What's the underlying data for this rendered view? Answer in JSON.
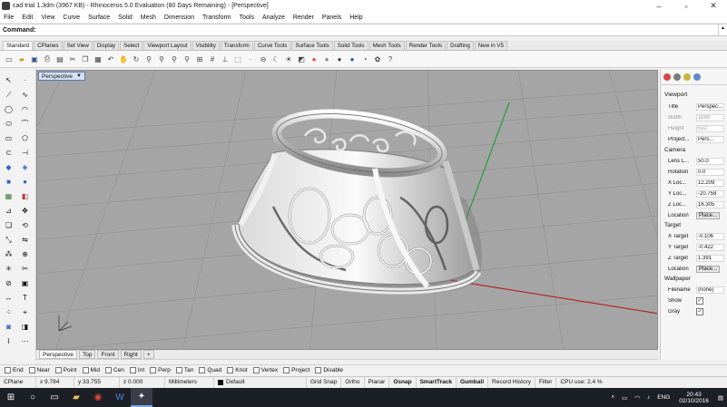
{
  "window": {
    "title": "cad trial 1.3dm (3967 KB) - Rhinoceros 5.0 Evaluation (80 Days Remaining) - [Perspective]"
  },
  "menu": [
    "File",
    "Edit",
    "View",
    "Curve",
    "Surface",
    "Solid",
    "Mesh",
    "Dimension",
    "Transform",
    "Tools",
    "Analyze",
    "Render",
    "Panels",
    "Help"
  ],
  "command": {
    "label": "Command:",
    "value": ""
  },
  "toolbar_tabs": [
    "Standard",
    "CPlanes",
    "Set View",
    "Display",
    "Select",
    "Viewport Layout",
    "Visibility",
    "Transform",
    "Curve Tools",
    "Surface Tools",
    "Solid Tools",
    "Mesh Tools",
    "Render Tools",
    "Drafting",
    "New in V5"
  ],
  "active_toolbar_tab": "Standard",
  "viewport": {
    "label": "Perspective"
  },
  "viewport_tabs": [
    "Perspective",
    "Top",
    "Front",
    "Right"
  ],
  "properties": {
    "section_viewport": "Viewport",
    "title_label": "Title",
    "title_value": "Perspec...",
    "width_label": "Width",
    "width_value": "1168",
    "height_label": "Height",
    "height_value": "522",
    "projection_label": "Project...",
    "projection_value": "Pers...",
    "section_camera": "Camera",
    "lens_label": "Lens L...",
    "lens_value": "50.0",
    "rotation_label": "Rotation",
    "rotation_value": "0.0",
    "xloc_label": "X Loc...",
    "xloc_value": "12.209",
    "yloc_label": "Y Loc...",
    "yloc_value": "-20.758",
    "zloc_label": "Z Loc...",
    "zloc_value": "16.305",
    "location_label": "Location",
    "place_button": "Place...",
    "section_target": "Target",
    "xtarget_label": "X Target",
    "xtarget_value": "-0.106",
    "ytarget_label": "Y Target",
    "ytarget_value": "-0.422",
    "ztarget_label": "Z Target",
    "ztarget_value": "1.391",
    "target_location_label": "Location",
    "target_place_button": "Place...",
    "section_wallpaper": "Wallpaper",
    "filename_label": "Filename",
    "filename_value": "(none)",
    "show_label": "Show",
    "gray_label": "Gray"
  },
  "osnaps": [
    "End",
    "Near",
    "Point",
    "Mid",
    "Cen",
    "Int",
    "Perp",
    "Tan",
    "Quad",
    "Knot",
    "Vertex",
    "Project",
    "Disable"
  ],
  "status": {
    "cplane": "CPlane",
    "x": "x 9.784",
    "y": "y 33.755",
    "z": "z 0.000",
    "units": "Millimeters",
    "layer": "Default",
    "grid_snap": "Grid Snap",
    "ortho": "Ortho",
    "planar": "Planar",
    "osnap": "Osnap",
    "smarttrack": "SmartTrack",
    "gumball": "Gumball",
    "record_history": "Record History",
    "filter": "Filter",
    "cpu": "CPU use: 2.4 %"
  },
  "taskbar": {
    "lang": "ENG",
    "time": "20:43",
    "date": "02/10/2016"
  },
  "colors": {
    "viewport_bg": "#a5a5a5",
    "grid_line": "#8e8e8e",
    "x_axis": "#b31d1d",
    "y_axis": "#1a9e2a",
    "taskbar_bg": "#1d1f27"
  }
}
